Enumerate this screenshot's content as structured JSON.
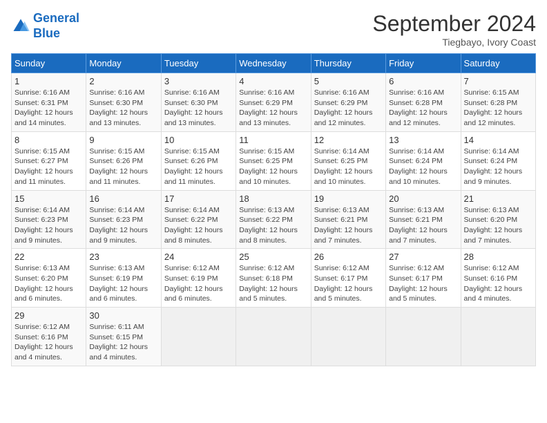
{
  "logo": {
    "line1": "General",
    "line2": "Blue"
  },
  "title": "September 2024",
  "subtitle": "Tiegbayo, Ivory Coast",
  "days_of_week": [
    "Sunday",
    "Monday",
    "Tuesday",
    "Wednesday",
    "Thursday",
    "Friday",
    "Saturday"
  ],
  "weeks": [
    [
      {
        "day": "1",
        "info": "Sunrise: 6:16 AM\nSunset: 6:31 PM\nDaylight: 12 hours\nand 14 minutes."
      },
      {
        "day": "2",
        "info": "Sunrise: 6:16 AM\nSunset: 6:30 PM\nDaylight: 12 hours\nand 13 minutes."
      },
      {
        "day": "3",
        "info": "Sunrise: 6:16 AM\nSunset: 6:30 PM\nDaylight: 12 hours\nand 13 minutes."
      },
      {
        "day": "4",
        "info": "Sunrise: 6:16 AM\nSunset: 6:29 PM\nDaylight: 12 hours\nand 13 minutes."
      },
      {
        "day": "5",
        "info": "Sunrise: 6:16 AM\nSunset: 6:29 PM\nDaylight: 12 hours\nand 12 minutes."
      },
      {
        "day": "6",
        "info": "Sunrise: 6:16 AM\nSunset: 6:28 PM\nDaylight: 12 hours\nand 12 minutes."
      },
      {
        "day": "7",
        "info": "Sunrise: 6:15 AM\nSunset: 6:28 PM\nDaylight: 12 hours\nand 12 minutes."
      }
    ],
    [
      {
        "day": "8",
        "info": "Sunrise: 6:15 AM\nSunset: 6:27 PM\nDaylight: 12 hours\nand 11 minutes."
      },
      {
        "day": "9",
        "info": "Sunrise: 6:15 AM\nSunset: 6:26 PM\nDaylight: 12 hours\nand 11 minutes."
      },
      {
        "day": "10",
        "info": "Sunrise: 6:15 AM\nSunset: 6:26 PM\nDaylight: 12 hours\nand 11 minutes."
      },
      {
        "day": "11",
        "info": "Sunrise: 6:15 AM\nSunset: 6:25 PM\nDaylight: 12 hours\nand 10 minutes."
      },
      {
        "day": "12",
        "info": "Sunrise: 6:14 AM\nSunset: 6:25 PM\nDaylight: 12 hours\nand 10 minutes."
      },
      {
        "day": "13",
        "info": "Sunrise: 6:14 AM\nSunset: 6:24 PM\nDaylight: 12 hours\nand 10 minutes."
      },
      {
        "day": "14",
        "info": "Sunrise: 6:14 AM\nSunset: 6:24 PM\nDaylight: 12 hours\nand 9 minutes."
      }
    ],
    [
      {
        "day": "15",
        "info": "Sunrise: 6:14 AM\nSunset: 6:23 PM\nDaylight: 12 hours\nand 9 minutes."
      },
      {
        "day": "16",
        "info": "Sunrise: 6:14 AM\nSunset: 6:23 PM\nDaylight: 12 hours\nand 9 minutes."
      },
      {
        "day": "17",
        "info": "Sunrise: 6:14 AM\nSunset: 6:22 PM\nDaylight: 12 hours\nand 8 minutes."
      },
      {
        "day": "18",
        "info": "Sunrise: 6:13 AM\nSunset: 6:22 PM\nDaylight: 12 hours\nand 8 minutes."
      },
      {
        "day": "19",
        "info": "Sunrise: 6:13 AM\nSunset: 6:21 PM\nDaylight: 12 hours\nand 7 minutes."
      },
      {
        "day": "20",
        "info": "Sunrise: 6:13 AM\nSunset: 6:21 PM\nDaylight: 12 hours\nand 7 minutes."
      },
      {
        "day": "21",
        "info": "Sunrise: 6:13 AM\nSunset: 6:20 PM\nDaylight: 12 hours\nand 7 minutes."
      }
    ],
    [
      {
        "day": "22",
        "info": "Sunrise: 6:13 AM\nSunset: 6:20 PM\nDaylight: 12 hours\nand 6 minutes."
      },
      {
        "day": "23",
        "info": "Sunrise: 6:13 AM\nSunset: 6:19 PM\nDaylight: 12 hours\nand 6 minutes."
      },
      {
        "day": "24",
        "info": "Sunrise: 6:12 AM\nSunset: 6:19 PM\nDaylight: 12 hours\nand 6 minutes."
      },
      {
        "day": "25",
        "info": "Sunrise: 6:12 AM\nSunset: 6:18 PM\nDaylight: 12 hours\nand 5 minutes."
      },
      {
        "day": "26",
        "info": "Sunrise: 6:12 AM\nSunset: 6:17 PM\nDaylight: 12 hours\nand 5 minutes."
      },
      {
        "day": "27",
        "info": "Sunrise: 6:12 AM\nSunset: 6:17 PM\nDaylight: 12 hours\nand 5 minutes."
      },
      {
        "day": "28",
        "info": "Sunrise: 6:12 AM\nSunset: 6:16 PM\nDaylight: 12 hours\nand 4 minutes."
      }
    ],
    [
      {
        "day": "29",
        "info": "Sunrise: 6:12 AM\nSunset: 6:16 PM\nDaylight: 12 hours\nand 4 minutes."
      },
      {
        "day": "30",
        "info": "Sunrise: 6:11 AM\nSunset: 6:15 PM\nDaylight: 12 hours\nand 4 minutes."
      },
      {
        "day": "",
        "info": ""
      },
      {
        "day": "",
        "info": ""
      },
      {
        "day": "",
        "info": ""
      },
      {
        "day": "",
        "info": ""
      },
      {
        "day": "",
        "info": ""
      }
    ]
  ]
}
